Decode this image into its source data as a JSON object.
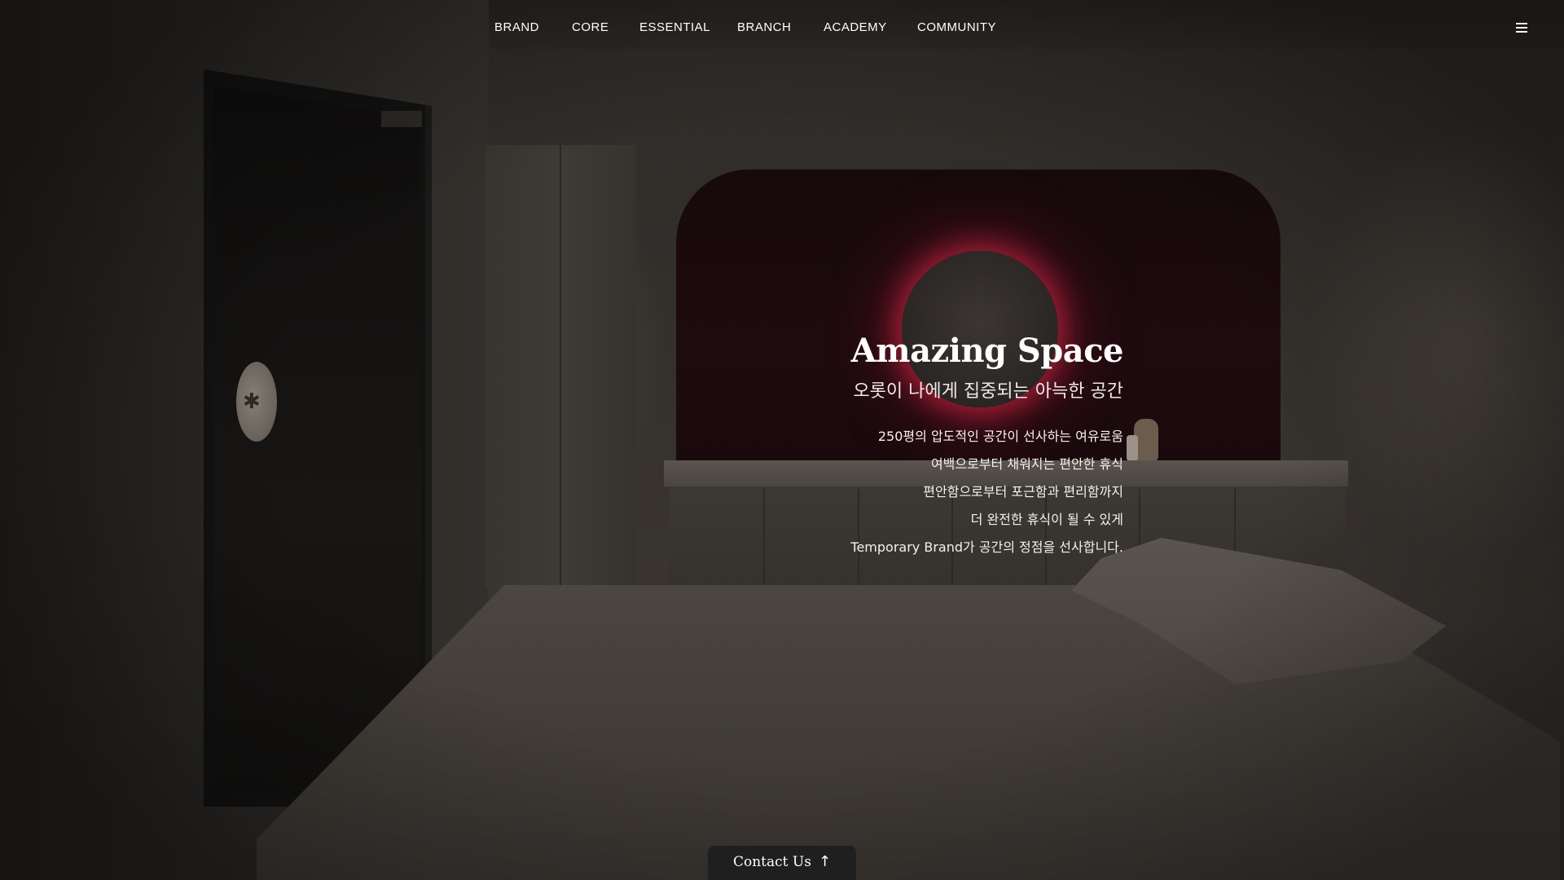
{
  "nav": {
    "items": [
      {
        "label": "BRAND"
      },
      {
        "label": "CORE"
      },
      {
        "label": "ESSENTIAL"
      },
      {
        "label": "BRANCH"
      },
      {
        "label": "ACADEMY"
      },
      {
        "label": "COMMUNITY"
      }
    ],
    "menu_icon": "hamburger-menu-icon"
  },
  "hero": {
    "title": "Amazing Space",
    "subtitle": "오롯이 나에게 집중되는 아늑한 공간",
    "lines": [
      "250평의 압도적인 공간이 선사하는 여유로움",
      "여백으로부터 채워지는 편안한 휴식",
      "편안함으로부터 포근함과 편리함까지",
      "더 완전한 휴식이 될 수 있게",
      "Temporary Brand가 공간의 정점을 선사합니다."
    ]
  },
  "contact": {
    "label": "Contact Us",
    "arrow": "↑"
  },
  "colors": {
    "nav_text": "#ffffff",
    "niche_glow": "#c8143c",
    "contact_bg": "#1f1f1f"
  }
}
